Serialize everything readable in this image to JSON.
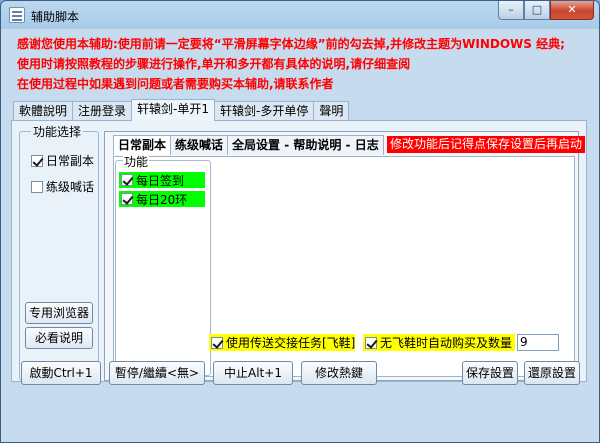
{
  "window": {
    "title": "辅助脚本",
    "minimize": "–",
    "maximize": "□",
    "close": "✕"
  },
  "notice": {
    "line1": "感谢您使用本辅助:使用前请一定要将“平滑屏幕字体边缘”前的勾去掉,并修改主题为WINDOWS 经典;",
    "line2": "使用时请按照教程的步骤进行操作,单开和多开都有具体的说明,请仔细查阅",
    "line3": "在使用过程中如果遇到问题或者需要购买本辅助,请联系作者"
  },
  "main_tabs": [
    "軟體說明",
    "注册登录",
    "轩辕剑-单开1",
    "轩辕剑-多开单停",
    "聲明"
  ],
  "function_group": {
    "title": "功能选择",
    "daily": "日常副本",
    "level_shout": "练级喊话",
    "browser_btn": "专用浏览器",
    "manual_btn": "必看说明"
  },
  "sub_tabs": [
    "日常副本",
    "练级喊话",
    "全局设置 - 帮助说明 - 日志"
  ],
  "red_note": "修改功能后记得点保存设置后再启动",
  "features": {
    "title": "功能",
    "daily_checkin": "每日签到",
    "daily_20rings": "每日20环"
  },
  "options": {
    "use_teleport": "使用传送交接任务[飞鞋]",
    "auto_buy": "无飞鞋时自动购买及数量",
    "quantity": "9"
  },
  "buttons": {
    "start": "啟動Ctrl+1",
    "pause": "暫停/繼續<無>",
    "stop": "中止Alt+1",
    "hotkey": "修改熱鍵",
    "save": "保存設置",
    "restore": "還原設置"
  }
}
